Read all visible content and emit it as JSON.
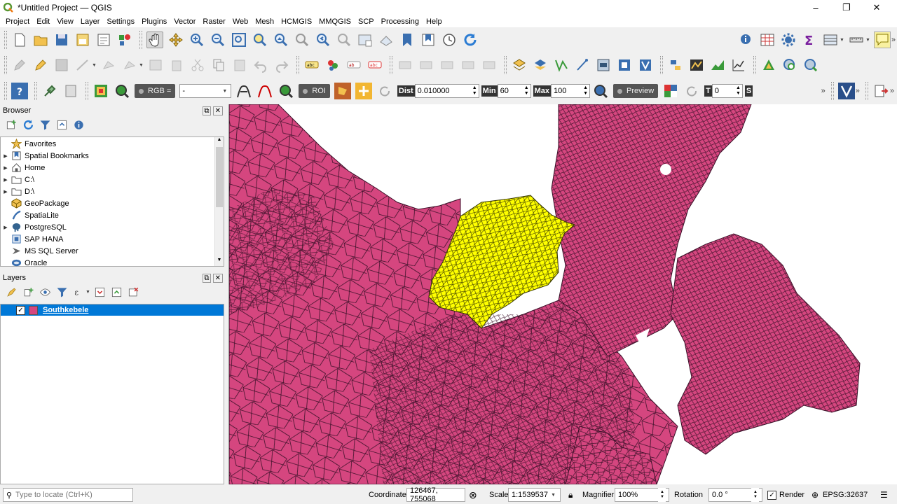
{
  "window": {
    "title": "*Untitled Project — QGIS",
    "controls": {
      "minimize": "–",
      "maximize": "❐",
      "close": "✕"
    }
  },
  "menu": [
    "Project",
    "Edit",
    "View",
    "Layer",
    "Settings",
    "Plugins",
    "Vector",
    "Raster",
    "Web",
    "Mesh",
    "HCMGIS",
    "MMQGIS",
    "SCP",
    "Processing",
    "Help"
  ],
  "scp_toolbar": {
    "rgb_label": "RGB =",
    "rgb_value": "-",
    "roi_label": "ROI",
    "dist_label": "Dist",
    "dist_value": "0.010000",
    "min_label": "Min",
    "min_value": "60",
    "max_label": "Max",
    "max_value": "100",
    "preview_label": "Preview",
    "t_label": "T",
    "t_value": "0",
    "s_label": "S",
    "more": "»"
  },
  "browser": {
    "title": "Browser",
    "items": [
      {
        "label": "Favorites",
        "icon": "star-icon",
        "expandable": false
      },
      {
        "label": "Spatial Bookmarks",
        "icon": "bookmark-icon",
        "expandable": true
      },
      {
        "label": "Home",
        "icon": "home-icon",
        "expandable": true
      },
      {
        "label": "C:\\",
        "icon": "folder-icon",
        "expandable": true
      },
      {
        "label": "D:\\",
        "icon": "folder-icon",
        "expandable": true
      },
      {
        "label": "GeoPackage",
        "icon": "geopackage-icon",
        "expandable": false
      },
      {
        "label": "SpatiaLite",
        "icon": "spatialite-icon",
        "expandable": false
      },
      {
        "label": "PostgreSQL",
        "icon": "postgresql-icon",
        "expandable": true
      },
      {
        "label": "SAP HANA",
        "icon": "sap-hana-icon",
        "expandable": false
      },
      {
        "label": "MS SQL Server",
        "icon": "mssql-icon",
        "expandable": false
      },
      {
        "label": "Oracle",
        "icon": "oracle-icon",
        "expandable": false
      }
    ]
  },
  "layers": {
    "title": "Layers",
    "items": [
      {
        "name": "Southkebele",
        "checked": true,
        "color": "#d5467f"
      }
    ]
  },
  "colors": {
    "polygon_fill": "#d5467f",
    "selected_fill": "#ffff00",
    "accent": "#3583d6"
  },
  "statusbar": {
    "locate_placeholder": "Type to locate (Ctrl+K)",
    "coordinate_label": "Coordinate",
    "coordinate_value": "126467, 755068",
    "scale_label": "Scale",
    "scale_value": "1:1539537",
    "magnifier_label": "Magnifier",
    "magnifier_value": "100%",
    "rotation_label": "Rotation",
    "rotation_value": "0.0 °",
    "render_label": "Render",
    "crs": "EPSG:32637"
  }
}
